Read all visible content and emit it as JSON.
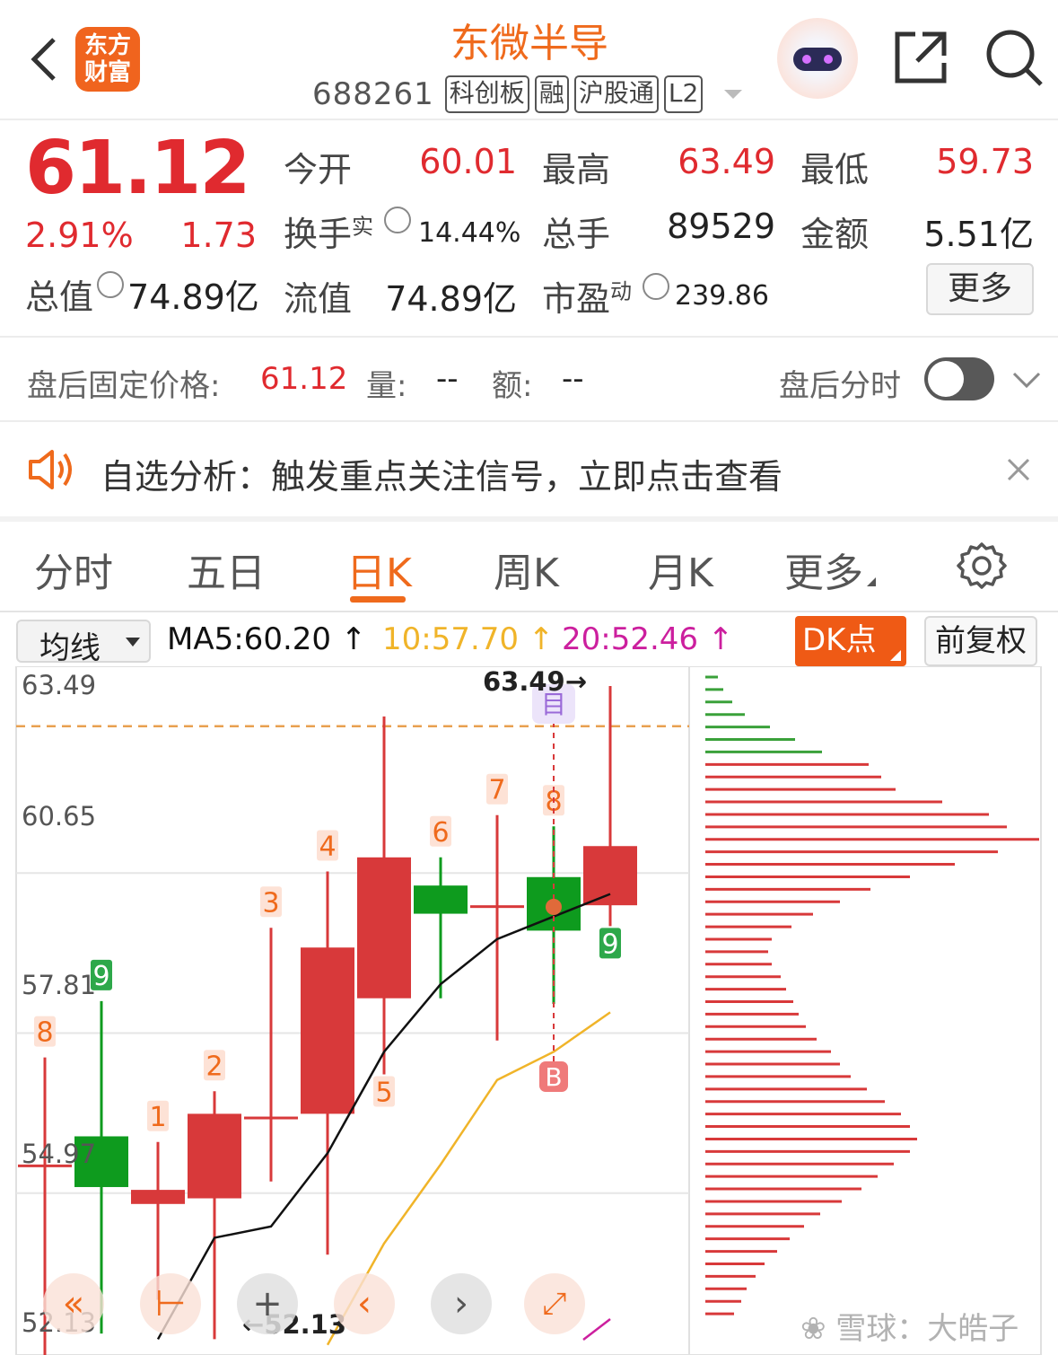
{
  "header": {
    "logo_line1": "东方",
    "logo_line2": "财富",
    "stock_name": "东微半导",
    "stock_code": "688261",
    "tags": [
      "科创板",
      "融",
      "沪股通",
      "L2"
    ]
  },
  "quote": {
    "price": "61.12",
    "change_pct": "2.91%",
    "change_abs": "1.73",
    "total_value_label": "总值",
    "total_value": "74.89亿",
    "open_label": "今开",
    "open": "60.01",
    "turnover_label": "换手",
    "turnover_sup": "实",
    "turnover": "14.44%",
    "float_label": "流值",
    "float_value": "74.89亿",
    "high_label": "最高",
    "high": "63.49",
    "volume_label": "总手",
    "volume": "89529",
    "pe_label": "市盈",
    "pe_sup": "动",
    "pe": "239.86",
    "low_label": "最低",
    "low": "59.73",
    "amount_label": "金额",
    "amount": "5.51亿",
    "more_button": "更多"
  },
  "after_hours": {
    "label": "盘后固定价格:",
    "price": "61.12",
    "vol_label": "量:",
    "vol": "--",
    "amt_label": "额:",
    "amt": "--",
    "toggle_label": "盘后分时",
    "toggle_on": false
  },
  "banner": {
    "text": "自选分析：触发重点关注信号，立即点击查看"
  },
  "tabs": [
    "分时",
    "五日",
    "日K",
    "周K",
    "月K",
    "更多"
  ],
  "active_tab": "日K",
  "toolbar": {
    "select_value": "均线",
    "ma5": "MA5:60.20",
    "ma10": "10:57.70",
    "ma20": "20:52.46",
    "dk_button": "DK点",
    "fq_button": "前复权"
  },
  "colors": {
    "up": "#d8393a",
    "down": "#0e9b1e",
    "accent": "#ef6a1c",
    "ma5": "#111111",
    "ma10": "#f0b429",
    "ma20": "#cc1f9e"
  },
  "chart_data": {
    "type": "candlestick",
    "y_ticks": [
      "63.49",
      "60.65",
      "57.81",
      "54.97",
      "52.13"
    ],
    "ylim": [
      52.13,
      63.49
    ],
    "max_label": "63.49",
    "min_label": "52.13",
    "last_close": 61.12,
    "candles": [
      {
        "open": 55.0,
        "close": 55.0,
        "high": 56.9,
        "low": 51.5,
        "count": "8",
        "count_type": "up"
      },
      {
        "open": 55.5,
        "close": 54.6,
        "high": 57.9,
        "low": 52.0,
        "count": "9",
        "count_type": "down"
      },
      {
        "open": 54.3,
        "close": 54.55,
        "high": 55.4,
        "low": 52.6,
        "count": "1",
        "count_type": "up"
      },
      {
        "open": 54.4,
        "close": 55.9,
        "high": 56.3,
        "low": 51.9,
        "count": "2",
        "count_type": "up"
      },
      {
        "open": 55.85,
        "close": 55.85,
        "high": 59.2,
        "low": 54.7,
        "count": "3",
        "count_type": "up"
      },
      {
        "open": 55.9,
        "close": 58.85,
        "high": 60.2,
        "low": 53.4,
        "count": "4",
        "count_type": "up"
      },
      {
        "open": 57.95,
        "close": 60.45,
        "high": 62.95,
        "low": 56.6,
        "count": "5",
        "count_type": "up_below"
      },
      {
        "open": 59.95,
        "close": 59.45,
        "high": 60.45,
        "low": 57.95,
        "count": "6",
        "count_type": "up"
      },
      {
        "open": 59.6,
        "close": 59.6,
        "high": 61.2,
        "low": 57.2,
        "count": "7",
        "count_type": "up"
      },
      {
        "open": 60.1,
        "close": 59.15,
        "high": 61.0,
        "low": 57.85,
        "count": "8",
        "count_type": "up"
      },
      {
        "open": 59.6,
        "close": 60.65,
        "high": 63.49,
        "low": 59.23,
        "count": "9",
        "count_type": "down_below"
      }
    ],
    "ma5": [
      null,
      null,
      51.9,
      53.7,
      53.9,
      55.2,
      57.0,
      58.2,
      59.0,
      59.4,
      59.8
    ],
    "ma10": [
      null,
      null,
      null,
      null,
      null,
      51.8,
      53.6,
      55.0,
      56.5,
      57.0,
      57.7
    ],
    "ma20": [
      null,
      null,
      null,
      null,
      null,
      null,
      null,
      null,
      null,
      null,
      51.7
    ],
    "signals": [
      {
        "candle_index": 9,
        "buy": "B",
        "mark": "目"
      }
    ],
    "volume_profile": {
      "green_levels": 7,
      "red_levels": 45
    }
  },
  "watermark": "雪球：大皓子"
}
